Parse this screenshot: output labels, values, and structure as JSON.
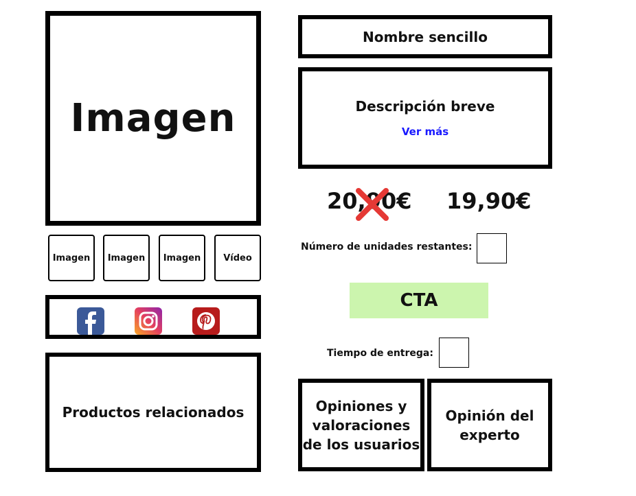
{
  "main_image": {
    "label": "Imagen"
  },
  "thumbnails": [
    "Imagen",
    "Imagen",
    "Imagen",
    "Vídeo"
  ],
  "social": {
    "icons": [
      "facebook-icon",
      "instagram-icon",
      "pinterest-icon"
    ],
    "colors": {
      "facebook": "#3b5998",
      "instagram": "#e4405f",
      "pinterest": "#b71c1c"
    }
  },
  "related": {
    "label": "Productos relacionados"
  },
  "product": {
    "name": "Nombre sencillo",
    "description": "Descripción breve",
    "see_more": "Ver más",
    "old_price": "20,90€",
    "new_price": "19,90€"
  },
  "units": {
    "label": "Número de unidades restantes:"
  },
  "cta": {
    "label": "CTA",
    "color": "#ccf5ae"
  },
  "delivery": {
    "label": "Tiempo de entrega:"
  },
  "reviews": {
    "users_label": "Opiniones y valoraciones de los usuarios",
    "expert_label": "Opinión del experto"
  },
  "accent_colors": {
    "link": "#1a1aff",
    "strike": "#e53935"
  }
}
